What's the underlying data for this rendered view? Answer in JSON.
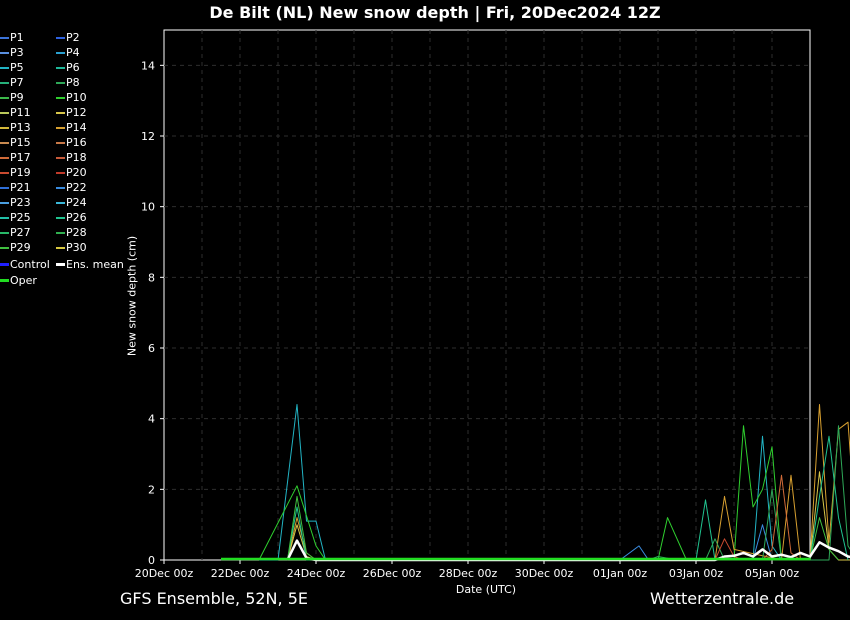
{
  "page": {
    "title": "De Bilt  (NL)  New snow depth | Fri, 20Dec2024 12Z",
    "footer_left": "GFS Ensemble, 52N, 5E",
    "footer_right": "Wetterzentrale.de"
  },
  "legend": {
    "members": [
      {
        "label": "P1",
        "color": "#3b73d9"
      },
      {
        "label": "P2",
        "color": "#2f62e0"
      },
      {
        "label": "P3",
        "color": "#5a8fe0"
      },
      {
        "label": "P4",
        "color": "#2aa0d0"
      },
      {
        "label": "P5",
        "color": "#22b4c4"
      },
      {
        "label": "P6",
        "color": "#1fb89a"
      },
      {
        "label": "P7",
        "color": "#26b07a"
      },
      {
        "label": "P8",
        "color": "#2ea858"
      },
      {
        "label": "P9",
        "color": "#3cb84a"
      },
      {
        "label": "P10",
        "color": "#2fcf2f"
      },
      {
        "label": "P11",
        "color": "#b9c85a"
      },
      {
        "label": "P12",
        "color": "#d7c64a"
      },
      {
        "label": "P13",
        "color": "#d4b83a"
      },
      {
        "label": "P14",
        "color": "#d8a030"
      },
      {
        "label": "P15",
        "color": "#c88a50"
      },
      {
        "label": "P16",
        "color": "#c87848"
      },
      {
        "label": "P17",
        "color": "#d06a38"
      },
      {
        "label": "P18",
        "color": "#c85a3a"
      },
      {
        "label": "P19",
        "color": "#c84a30"
      },
      {
        "label": "P20",
        "color": "#c03a2a"
      },
      {
        "label": "P21",
        "color": "#2f6fd8"
      },
      {
        "label": "P22",
        "color": "#3a8ce0"
      },
      {
        "label": "P23",
        "color": "#4a9ee0"
      },
      {
        "label": "P24",
        "color": "#3ab8d8"
      },
      {
        "label": "P25",
        "color": "#22c0a8"
      },
      {
        "label": "P26",
        "color": "#20c490"
      },
      {
        "label": "P27",
        "color": "#28b868"
      },
      {
        "label": "P28",
        "color": "#30b050"
      },
      {
        "label": "P29",
        "color": "#40c040"
      },
      {
        "label": "P30",
        "color": "#d8c840"
      }
    ],
    "control": {
      "label": "Control",
      "color": "#2020ff"
    },
    "ens_mean": {
      "label": "Ens. mean",
      "color": "#ffffff"
    },
    "oper": {
      "label": "Oper",
      "color": "#22dd22"
    }
  },
  "chart_data": {
    "type": "line",
    "title": "De Bilt  (NL)  New snow depth | Fri, 20Dec2024 12Z",
    "xlabel": "Date (UTC)",
    "ylabel": "New snow depth (cm)",
    "xlim": [
      "2024-12-20 00z",
      "2025-01-06 00z"
    ],
    "ylim": [
      0,
      15
    ],
    "grid": true,
    "x_ticks": [
      "20Dec 00z",
      "22Dec 00z",
      "24Dec 00z",
      "26Dec 00z",
      "28Dec 00z",
      "30Dec 00z",
      "01Jan 00z",
      "03Jan 00z",
      "05Jan 00z"
    ],
    "y_ticks": [
      0,
      2,
      4,
      6,
      8,
      10,
      12,
      14
    ],
    "x_unit": "days since 20Dec 00z",
    "series": [
      {
        "name": "P5",
        "color": "#22b4c4",
        "points": [
          [
            2.5,
            0
          ],
          [
            3.0,
            0
          ],
          [
            3.5,
            4.4
          ],
          [
            3.75,
            1.1
          ],
          [
            4.0,
            1.1
          ],
          [
            4.25,
            0
          ],
          [
            4.5,
            0
          ],
          [
            15.5,
            0
          ],
          [
            15.75,
            3.5
          ],
          [
            16.0,
            0.4
          ],
          [
            16.25,
            0
          ]
        ]
      },
      {
        "name": "P10",
        "color": "#2fcf2f",
        "points": [
          [
            2.5,
            0
          ],
          [
            3.5,
            2.1
          ],
          [
            4.0,
            0.4
          ],
          [
            4.25,
            0
          ],
          [
            13.0,
            0
          ],
          [
            13.25,
            1.2
          ],
          [
            13.75,
            0
          ],
          [
            15.0,
            0
          ],
          [
            15.25,
            3.8
          ],
          [
            15.5,
            1.5
          ],
          [
            15.75,
            2.0
          ],
          [
            16.0,
            3.2
          ],
          [
            16.25,
            0
          ],
          [
            17.0,
            0
          ]
        ]
      },
      {
        "name": "P14",
        "color": "#d8a030",
        "points": [
          [
            3.25,
            0
          ],
          [
            3.5,
            1.2
          ],
          [
            3.75,
            0.2
          ],
          [
            4.0,
            0
          ],
          [
            14.5,
            0
          ],
          [
            14.75,
            1.8
          ],
          [
            15.0,
            0.3
          ],
          [
            16.25,
            0
          ],
          [
            16.5,
            2.4
          ],
          [
            16.75,
            0
          ],
          [
            17.0,
            0
          ],
          [
            17.25,
            4.4
          ],
          [
            17.5,
            0.5
          ],
          [
            17.75,
            3.7
          ],
          [
            18.0,
            3.9
          ],
          [
            18.25,
            0.2
          ],
          [
            18.5,
            0
          ]
        ]
      },
      {
        "name": "P12",
        "color": "#d7c64a",
        "points": [
          [
            3.25,
            0
          ],
          [
            3.5,
            1.0
          ],
          [
            3.75,
            0.1
          ],
          [
            4.0,
            0
          ],
          [
            17.0,
            0
          ],
          [
            17.25,
            2.5
          ],
          [
            17.5,
            0.3
          ],
          [
            17.75,
            0
          ],
          [
            18.25,
            0
          ],
          [
            18.5,
            2.0
          ],
          [
            18.75,
            0
          ]
        ]
      },
      {
        "name": "P26",
        "color": "#20c490",
        "points": [
          [
            3.25,
            0
          ],
          [
            3.5,
            1.5
          ],
          [
            3.75,
            0
          ],
          [
            14.0,
            0
          ],
          [
            14.25,
            1.7
          ],
          [
            14.5,
            0
          ],
          [
            17.0,
            0
          ],
          [
            17.25,
            1.8
          ],
          [
            17.5,
            3.5
          ],
          [
            17.75,
            1.2
          ],
          [
            18.0,
            0
          ]
        ]
      },
      {
        "name": "P22",
        "color": "#3a8ce0",
        "points": [
          [
            12.0,
            0
          ],
          [
            12.5,
            0.4
          ],
          [
            12.75,
            0
          ],
          [
            15.5,
            0
          ],
          [
            15.75,
            1.0
          ],
          [
            16.0,
            0
          ]
        ]
      },
      {
        "name": "P8",
        "color": "#2ea858",
        "points": [
          [
            12.75,
            0
          ],
          [
            13.0,
            0.1
          ],
          [
            13.5,
            0
          ],
          [
            14.25,
            0
          ],
          [
            14.5,
            0.6
          ],
          [
            14.75,
            0
          ],
          [
            15.75,
            0
          ],
          [
            16.0,
            2.0
          ],
          [
            16.25,
            0
          ],
          [
            17.5,
            0
          ],
          [
            17.75,
            3.8
          ],
          [
            18.0,
            0.4
          ],
          [
            18.25,
            0
          ]
        ]
      },
      {
        "name": "P17",
        "color": "#d06a38",
        "points": [
          [
            15.75,
            0
          ],
          [
            16.0,
            0.3
          ],
          [
            16.25,
            2.4
          ],
          [
            16.5,
            0.2
          ],
          [
            16.75,
            0
          ]
        ]
      },
      {
        "name": "P19",
        "color": "#c84a30",
        "points": [
          [
            14.5,
            0
          ],
          [
            14.75,
            0.6
          ],
          [
            15.0,
            0.1
          ],
          [
            15.25,
            0
          ]
        ]
      },
      {
        "name": "P29",
        "color": "#40c040",
        "points": [
          [
            3.25,
            0
          ],
          [
            3.5,
            1.8
          ],
          [
            3.75,
            0.2
          ],
          [
            4.0,
            0
          ],
          [
            17.0,
            0
          ],
          [
            17.25,
            1.2
          ],
          [
            17.5,
            0.3
          ],
          [
            17.75,
            0
          ]
        ]
      },
      {
        "name": "Ens. mean",
        "color": "#ffffff",
        "points": [
          [
            3.25,
            0
          ],
          [
            3.5,
            0.55
          ],
          [
            3.75,
            0.05
          ],
          [
            4.0,
            0
          ],
          [
            14.5,
            0
          ],
          [
            14.75,
            0.1
          ],
          [
            15.0,
            0.12
          ],
          [
            15.25,
            0.2
          ],
          [
            15.5,
            0.1
          ],
          [
            15.75,
            0.3
          ],
          [
            16.0,
            0.1
          ],
          [
            16.25,
            0.15
          ],
          [
            16.5,
            0.08
          ],
          [
            16.75,
            0.2
          ],
          [
            17.0,
            0.1
          ],
          [
            17.25,
            0.5
          ],
          [
            17.5,
            0.35
          ],
          [
            17.75,
            0.25
          ],
          [
            18.0,
            0.1
          ],
          [
            18.25,
            0.05
          ],
          [
            18.5,
            0.2
          ],
          [
            18.75,
            0
          ]
        ]
      }
    ]
  }
}
